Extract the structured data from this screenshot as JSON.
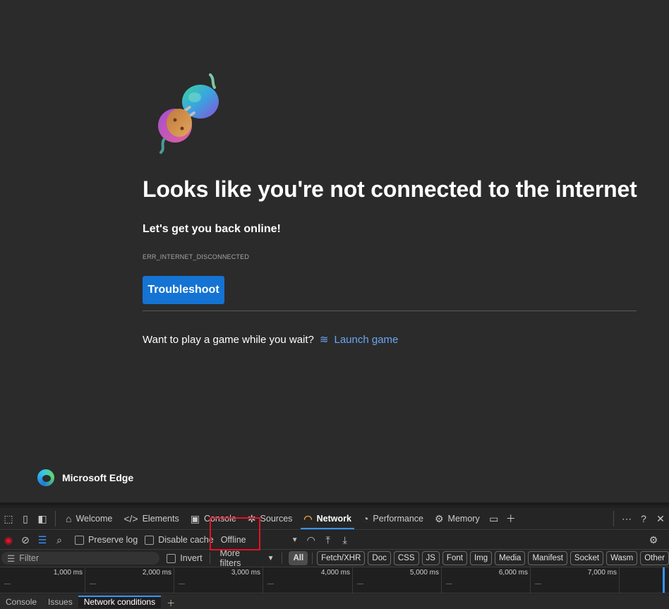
{
  "page": {
    "headline": "Looks like you're not connected to the internet",
    "subheadline": "Let's get you back online!",
    "error_code": "ERR_INTERNET_DISCONNECTED",
    "troubleshoot_label": "Troubleshoot",
    "game_prompt": "Want to play a game while you wait?",
    "launch_game_label": "Launch game",
    "brand_name": "Microsoft Edge"
  },
  "devtools": {
    "tabs": [
      {
        "label": "Welcome",
        "icon": "home-icon"
      },
      {
        "label": "Elements",
        "icon": "code-icon"
      },
      {
        "label": "Console",
        "icon": "console-icon"
      },
      {
        "label": "Sources",
        "icon": "bug-icon"
      },
      {
        "label": "Network",
        "icon": "wifi-warning-icon",
        "active": true
      },
      {
        "label": "Performance",
        "icon": "performance-icon"
      },
      {
        "label": "Memory",
        "icon": "chip-icon"
      }
    ],
    "toolbar": {
      "preserve_log": "Preserve log",
      "disable_cache": "Disable cache",
      "throttling": "Offline"
    },
    "filter": {
      "placeholder": "Filter",
      "invert": "Invert",
      "more_filters": "More filters",
      "types": [
        "All",
        "Fetch/XHR",
        "Doc",
        "CSS",
        "JS",
        "Font",
        "Img",
        "Media",
        "Manifest",
        "Socket",
        "Wasm",
        "Other"
      ]
    },
    "timeline_ticks": [
      "1,000 ms",
      "2,000 ms",
      "3,000 ms",
      "4,000 ms",
      "5,000 ms",
      "6,000 ms",
      "7,000 ms"
    ],
    "drawer_tabs": [
      "Console",
      "Issues",
      "Network conditions"
    ]
  },
  "colors": {
    "accent": "#1473d3",
    "link": "#6ba6f5",
    "highlight_box": "#e81123"
  }
}
